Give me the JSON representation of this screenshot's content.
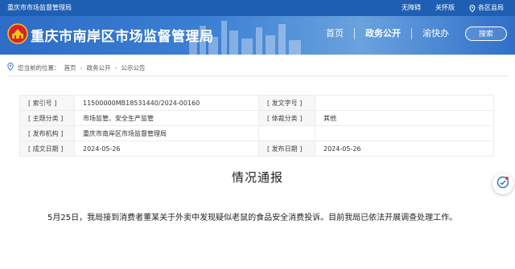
{
  "topbar": {
    "site_name": "重庆市市场监督管理局",
    "accessibility": "无障碍",
    "care_mode": "关怀版",
    "district": "各区县局"
  },
  "header": {
    "site_title": "重庆市南岸区市场监督管理局",
    "nav": [
      "首页",
      "政务公开",
      "渝快办"
    ],
    "search_label": "搜索"
  },
  "breadcrumb": {
    "prefix": "您当前的位置：",
    "items": [
      "首页",
      "政务公开",
      "公示公告"
    ]
  },
  "info_table": {
    "rows": [
      {
        "label1": "[ 索引号 ]",
        "value1": "11500000MB18531440/2024-00160",
        "label2": "[ 发文字号 ]",
        "value2": ""
      },
      {
        "label1": "[ 主题分类 ]",
        "value1": "市场监管、安全生产监管",
        "label2": "[ 体裁分类 ]",
        "value2": "其他"
      },
      {
        "label1": "[ 发布机构 ]",
        "value1": "重庆市南岸区市场监督管理局",
        "label2": "",
        "value2": ""
      },
      {
        "label1": "[ 成文日期 ]",
        "value1": "2024-05-26",
        "label2": "[ 发布日期 ]",
        "value2": "2024-05-26"
      }
    ]
  },
  "article": {
    "title": "情况通报",
    "body": "5月25日，我局接到消费者董某关于外卖中发现疑似老鼠的食品安全消费投诉。目前我局已依法开展调查处理工作。"
  }
}
